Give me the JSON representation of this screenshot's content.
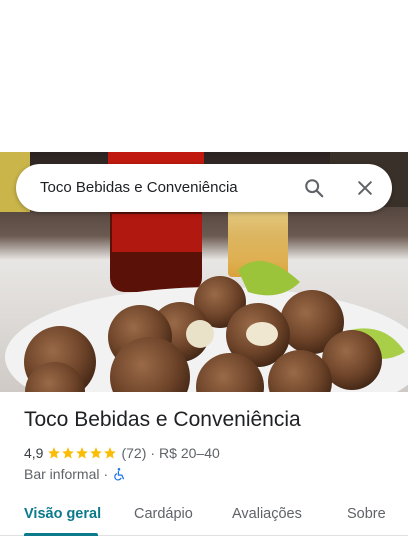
{
  "search": {
    "query": "Toco Bebidas e Conveniência",
    "search_icon": "search-icon",
    "close_icon": "close-icon"
  },
  "place": {
    "title": "Toco Bebidas e Conveniência",
    "rating": "4,9",
    "stars": 5,
    "reviews": "(72)",
    "separator": "·",
    "price_range": "R$ 20–40",
    "category": "Bar informal",
    "category_separator": "·",
    "accessibility_icon": "wheelchair-icon"
  },
  "tabs": [
    {
      "label": "Visão geral",
      "active": true
    },
    {
      "label": "Cardápio",
      "active": false
    },
    {
      "label": "Avaliações",
      "active": false
    },
    {
      "label": "Sobre",
      "active": false
    }
  ],
  "colors": {
    "accent": "#0b7a8a",
    "star": "#fbbc04",
    "accessibility": "#1a73e8"
  }
}
